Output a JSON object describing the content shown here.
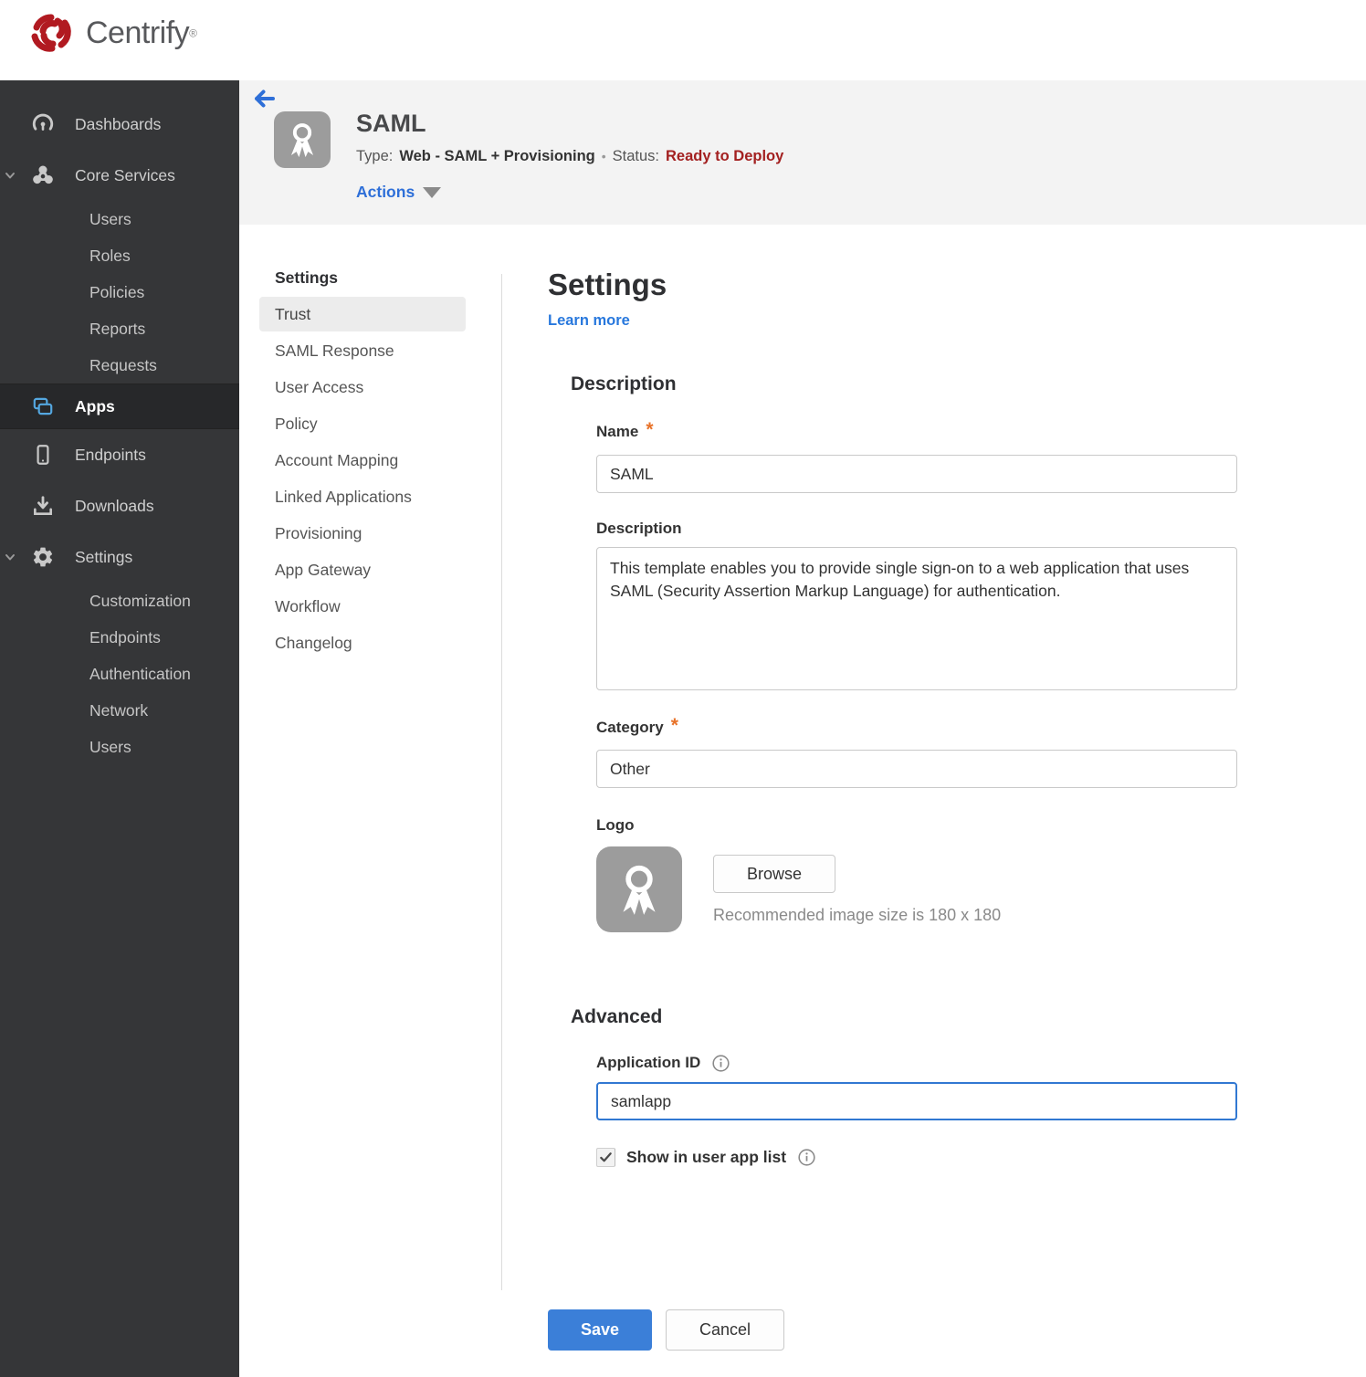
{
  "brand": {
    "name": "Centrify",
    "trademark": "®"
  },
  "colors": {
    "sidebar_bg": "#353638",
    "sidebar_selected_bg": "#27282a",
    "header_band_bg": "#f3f3f3",
    "accent_blue": "#2e6fd8",
    "save_button_blue": "#3b7fd8",
    "status_red": "#a32020",
    "required_orange": "#e8732a",
    "apps_icon_blue": "#54a7e0",
    "focused_input_border": "#3178d2"
  },
  "sidebar": {
    "items": [
      {
        "label": "Dashboards",
        "icon": "gauge-icon",
        "level": 1
      },
      {
        "label": "Core Services",
        "icon": "core-services-icon",
        "level": 1,
        "expanded": true
      },
      {
        "label": "Users",
        "level": 2
      },
      {
        "label": "Roles",
        "level": 2
      },
      {
        "label": "Policies",
        "level": 2
      },
      {
        "label": "Reports",
        "level": 2
      },
      {
        "label": "Requests",
        "level": 2
      },
      {
        "label": "Apps",
        "icon": "apps-icon",
        "level": 1,
        "selected": true
      },
      {
        "label": "Endpoints",
        "icon": "device-icon",
        "level": 1
      },
      {
        "label": "Downloads",
        "icon": "download-icon",
        "level": 1
      },
      {
        "label": "Settings",
        "icon": "gear-icon",
        "level": 1,
        "expanded": true
      },
      {
        "label": "Customization",
        "level": 2
      },
      {
        "label": "Endpoints",
        "level": 2
      },
      {
        "label": "Authentication",
        "level": 2
      },
      {
        "label": "Network",
        "level": 2
      },
      {
        "label": "Users",
        "level": 2
      }
    ]
  },
  "app_header": {
    "title": "SAML",
    "type_label": "Type:",
    "type_value": "Web - SAML + Provisioning",
    "separator": "•",
    "status_label": "Status:",
    "status_value": "Ready to Deploy",
    "actions_label": "Actions"
  },
  "subnav": {
    "header": "Settings",
    "selected": "Trust",
    "items": [
      "Trust",
      "SAML Response",
      "User Access",
      "Policy",
      "Account Mapping",
      "Linked Applications",
      "Provisioning",
      "App Gateway",
      "Workflow",
      "Changelog"
    ]
  },
  "main": {
    "title": "Settings",
    "learn_more": "Learn more",
    "required_marker": "*",
    "description_section": {
      "heading": "Description",
      "name_label": "Name",
      "name_value": "SAML",
      "description_label": "Description",
      "description_value": "This template enables you to provide single sign-on to a web application that uses SAML (Security Assertion Markup Language) for authentication.",
      "category_label": "Category",
      "category_value": "Other",
      "logo_label": "Logo",
      "browse_label": "Browse",
      "logo_hint": "Recommended image size is 180 x 180"
    },
    "advanced_section": {
      "heading": "Advanced",
      "app_id_label": "Application ID",
      "app_id_value": "samlapp",
      "show_in_list_label": "Show in user app list",
      "show_in_list_checked": true
    },
    "save_label": "Save",
    "cancel_label": "Cancel"
  }
}
